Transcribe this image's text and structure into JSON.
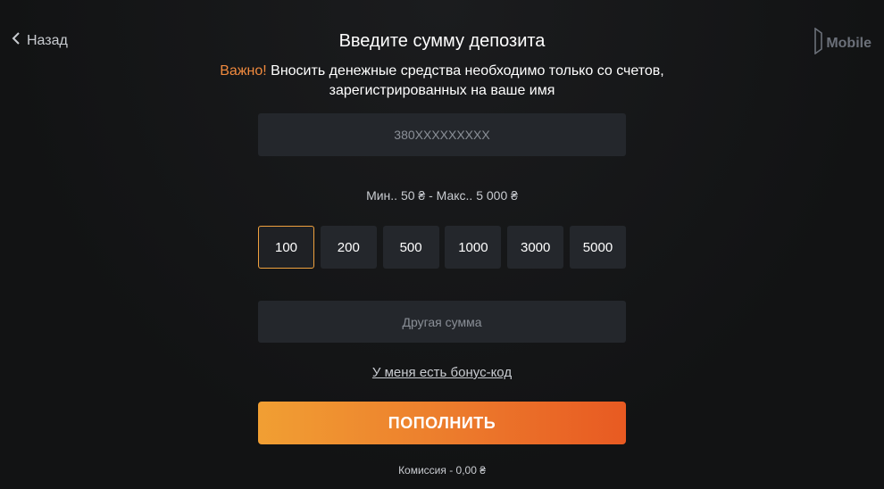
{
  "header": {
    "back_label": "Назад",
    "logo_text": "Mobile",
    "title": "Введите сумму депозита"
  },
  "notice": {
    "important": "Важно!",
    "text": " Вносить денежные средства необходимо только со счетов,",
    "text_line2": "зарегистрированных на ваше имя"
  },
  "phone_field": {
    "placeholder": "380XXXXXXXXX"
  },
  "limits_text": "Мин.. 50 ₴ - Макс.. 5 000 ₴",
  "amounts": [
    {
      "label": "100",
      "selected": true
    },
    {
      "label": "200",
      "selected": false
    },
    {
      "label": "500",
      "selected": false
    },
    {
      "label": "1000",
      "selected": false
    },
    {
      "label": "3000",
      "selected": false
    },
    {
      "label": "5000",
      "selected": false
    }
  ],
  "other_amount": {
    "placeholder": "Другая сумма"
  },
  "bonus_link": "У меня есть бонус-код",
  "submit_label": "ПОПОЛНИТЬ",
  "fee_text": "Комиссия - 0,00 ₴",
  "colors": {
    "accent": "#f08a3e",
    "button_start": "#f19f33",
    "button_end": "#e85a22",
    "field_bg": "#24272c",
    "selected_border": "#f0a13e"
  },
  "icons": {
    "back": "chevron-left-icon",
    "logo": "mobile-logo-icon"
  }
}
